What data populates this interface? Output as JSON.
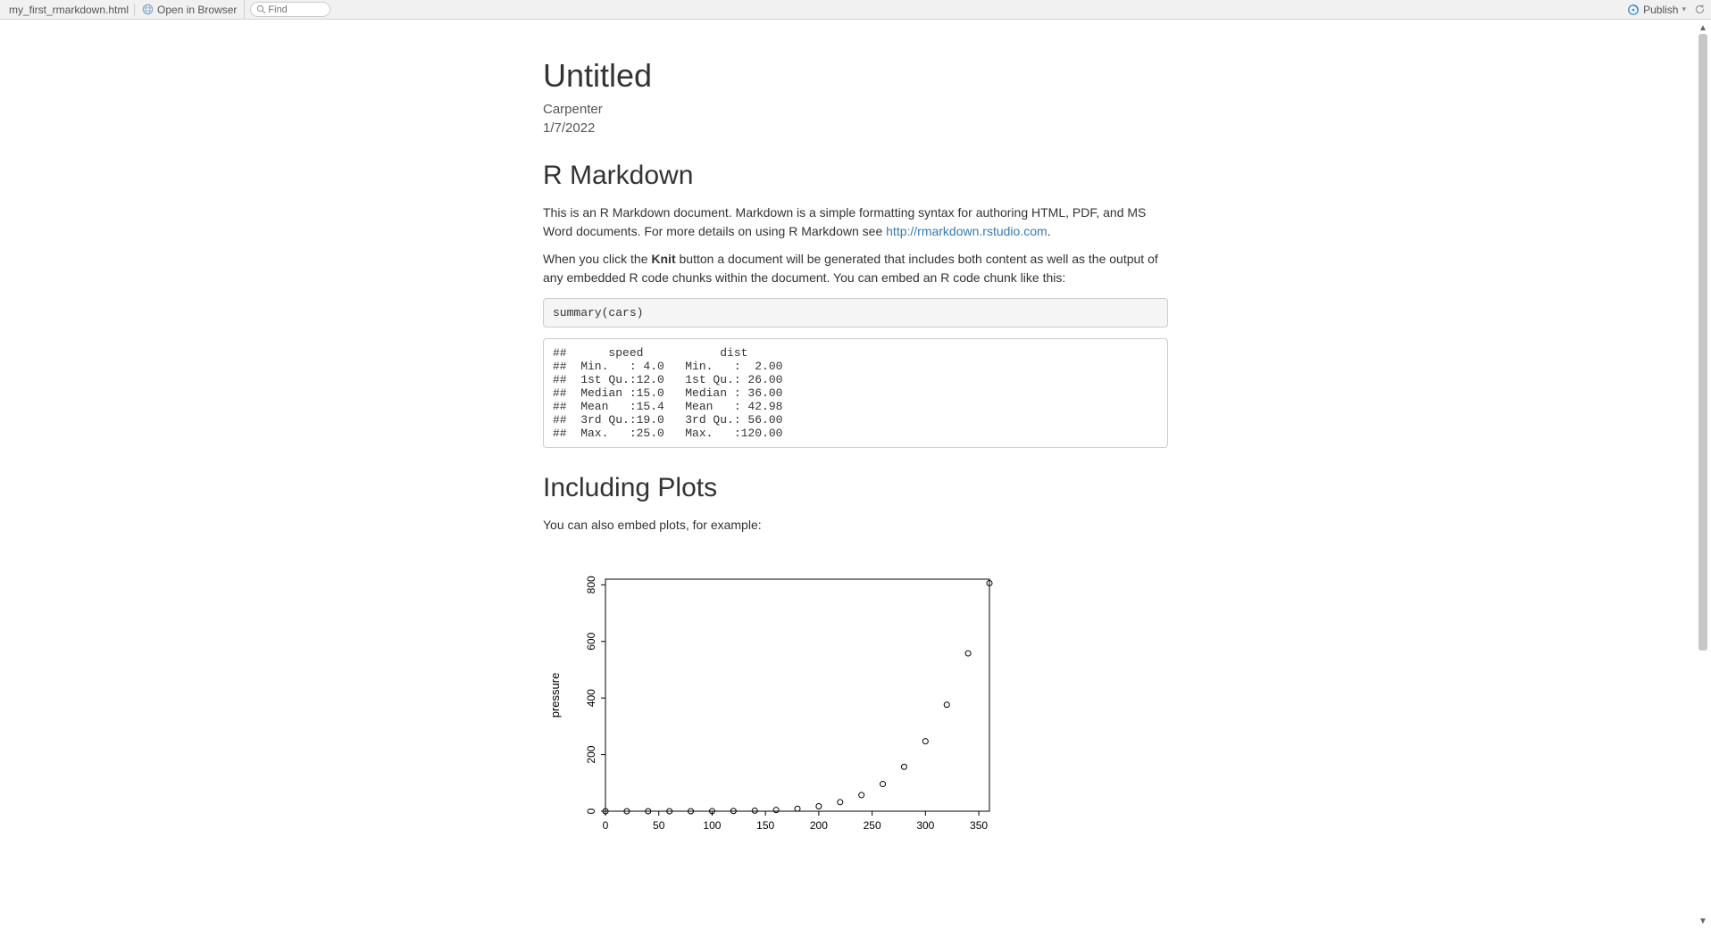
{
  "toolbar": {
    "filename": "my_first_rmarkdown.html",
    "open_in_browser": "Open in Browser",
    "find_placeholder": "Find",
    "publish": "Publish"
  },
  "doc": {
    "title": "Untitled",
    "author": "Carpenter",
    "date": "1/7/2022",
    "h2a": "R Markdown",
    "p1_before": "This is an R Markdown document. Markdown is a simple formatting syntax for authoring HTML, PDF, and MS Word documents. For more details on using R Markdown see ",
    "p1_link_text": "http://rmarkdown.rstudio.com",
    "p1_after": ".",
    "p2_before": "When you click the ",
    "p2_strong": "Knit",
    "p2_after": " button a document will be generated that includes both content as well as the output of any embedded R code chunks within the document. You can embed an R code chunk like this:",
    "code1": "summary(cars)",
    "output1": "##      speed           dist       \n##  Min.   : 4.0   Min.   :  2.00  \n##  1st Qu.:12.0   1st Qu.: 26.00  \n##  Median :15.0   Median : 36.00  \n##  Mean   :15.4   Mean   : 42.98  \n##  3rd Qu.:19.0   3rd Qu.: 56.00  \n##  Max.   :25.0   Max.   :120.00",
    "h2b": "Including Plots",
    "p3": "You can also embed plots, for example:"
  },
  "chart_data": {
    "type": "scatter",
    "title": "",
    "xlabel": "",
    "ylabel": "pressure",
    "xlim": [
      0,
      360
    ],
    "ylim": [
      0,
      820
    ],
    "xticks": [
      0,
      50,
      100,
      150,
      200,
      250,
      300,
      350
    ],
    "yticks": [
      0,
      200,
      400,
      600,
      800
    ],
    "x": [
      0,
      20,
      40,
      60,
      80,
      100,
      120,
      140,
      160,
      180,
      200,
      220,
      240,
      260,
      280,
      300,
      320,
      340,
      360
    ],
    "y": [
      0.0002,
      0.0012,
      0.006,
      0.03,
      0.09,
      0.27,
      0.75,
      1.85,
      4.2,
      8.8,
      17.3,
      32.1,
      57,
      96,
      157,
      247,
      376,
      558,
      806
    ]
  }
}
